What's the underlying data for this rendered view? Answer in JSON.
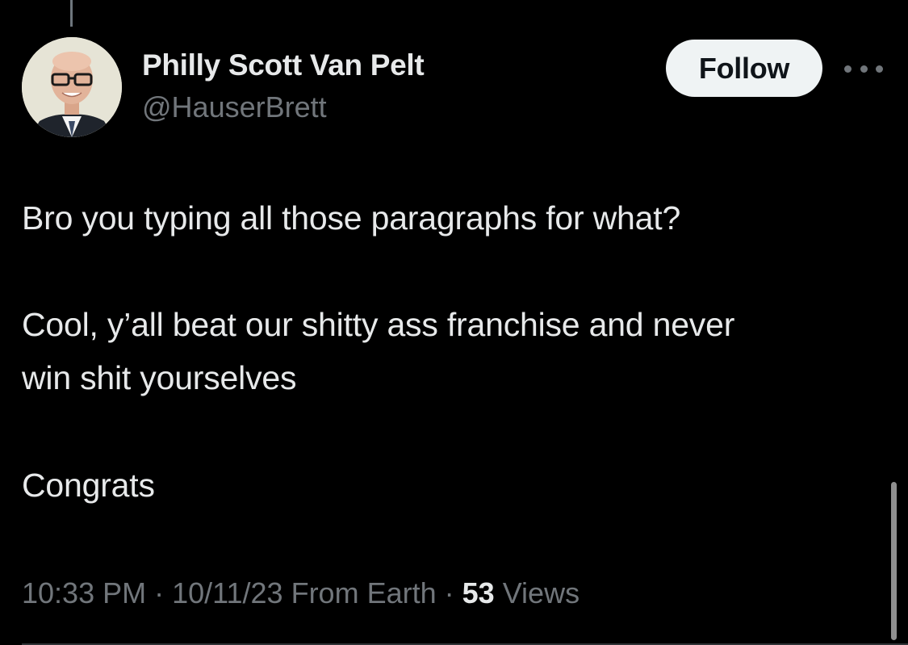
{
  "author": {
    "display_name": "Philly Scott Van Pelt",
    "handle": "@HauserBrett"
  },
  "follow_button": {
    "label": "Follow"
  },
  "more_icon": {
    "icon": "more-horizontal-icon"
  },
  "tweet": {
    "lines": [
      "Bro you typing all those paragraphs for what?",
      "Cool, y’all beat our shitty ass franchise and never",
      "win shit yourselves",
      "Congrats"
    ]
  },
  "meta": {
    "time": "10:33 PM",
    "separator": " · ",
    "date": "10/11/23",
    "source": "From Earth",
    "views_count": "53",
    "views_label": "Views"
  },
  "colors": {
    "background": "#000000",
    "text_primary": "#e7e9ea",
    "text_secondary": "#71767b",
    "follow_bg": "#eff3f4",
    "follow_text": "#0f1419"
  }
}
